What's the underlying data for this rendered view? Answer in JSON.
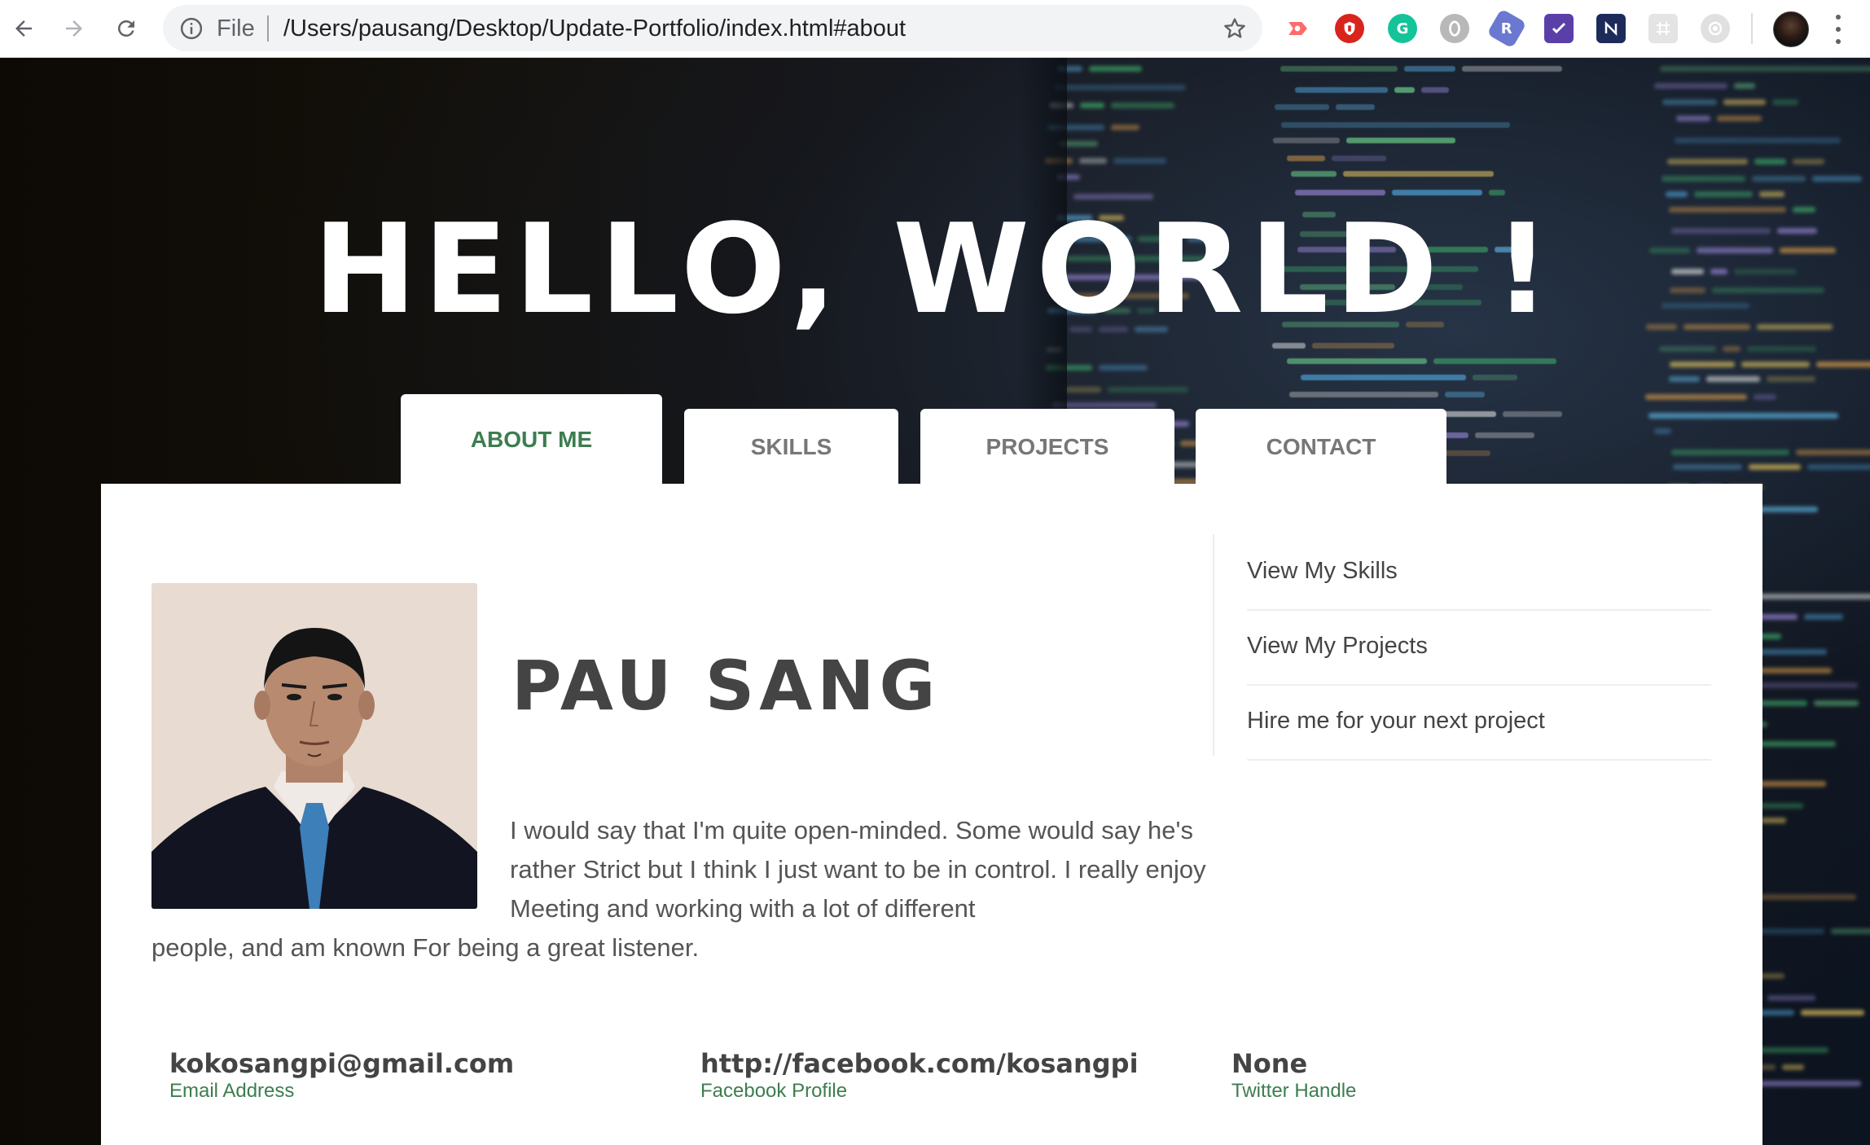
{
  "browser": {
    "omnibox": {
      "scheme_label": "File",
      "url": "/Users/pausang/Desktop/Update-Portfolio/index.html#about"
    },
    "extensions": [
      {
        "name": "cast-extension",
        "color": "#ff6b6b"
      },
      {
        "name": "ublock-extension",
        "color": "#d9241c"
      },
      {
        "name": "grammarly-extension",
        "color": "#15c39a",
        "glyph": "G"
      },
      {
        "name": "opera-extension",
        "color": "#b0b0b0"
      },
      {
        "name": "react-extension",
        "color": "#6a78d1",
        "glyph": "R"
      },
      {
        "name": "checklist-extension",
        "color": "#5b3fa8"
      },
      {
        "name": "notion-extension",
        "color": "#1d2b5a"
      },
      {
        "name": "grid-extension",
        "color": "#d0d0d0"
      },
      {
        "name": "record-extension",
        "color": "#c8c8c8"
      }
    ]
  },
  "hero": {
    "title": "HELLO, WORLD !"
  },
  "tabs": [
    {
      "label": "About Me",
      "active": true
    },
    {
      "label": "Skills",
      "active": false
    },
    {
      "label": "Projects",
      "active": false
    },
    {
      "label": "Contact",
      "active": false
    }
  ],
  "about": {
    "name": "PAU SANG",
    "bio_line1": "I would say that I'm quite open-minded. Some would say he's rather Strict but I think I just want to be in control. I really enjoy Meeting and working with a lot of different",
    "bio_line2": "people, and am known For being a great listener."
  },
  "side_links": [
    {
      "label": "View My Skills"
    },
    {
      "label": "View My Projects"
    },
    {
      "label": "Hire me for your next project"
    }
  ],
  "contacts": [
    {
      "value": "kokosangpi@gmail.com",
      "label": "Email Address"
    },
    {
      "value": "http://facebook.com/kosangpi",
      "label": "Facebook Profile"
    },
    {
      "value": "None",
      "label": "Twitter Handle"
    }
  ],
  "colors": {
    "accent": "#3d7d4f",
    "text": "#444444",
    "tab_inactive": "#777777"
  }
}
